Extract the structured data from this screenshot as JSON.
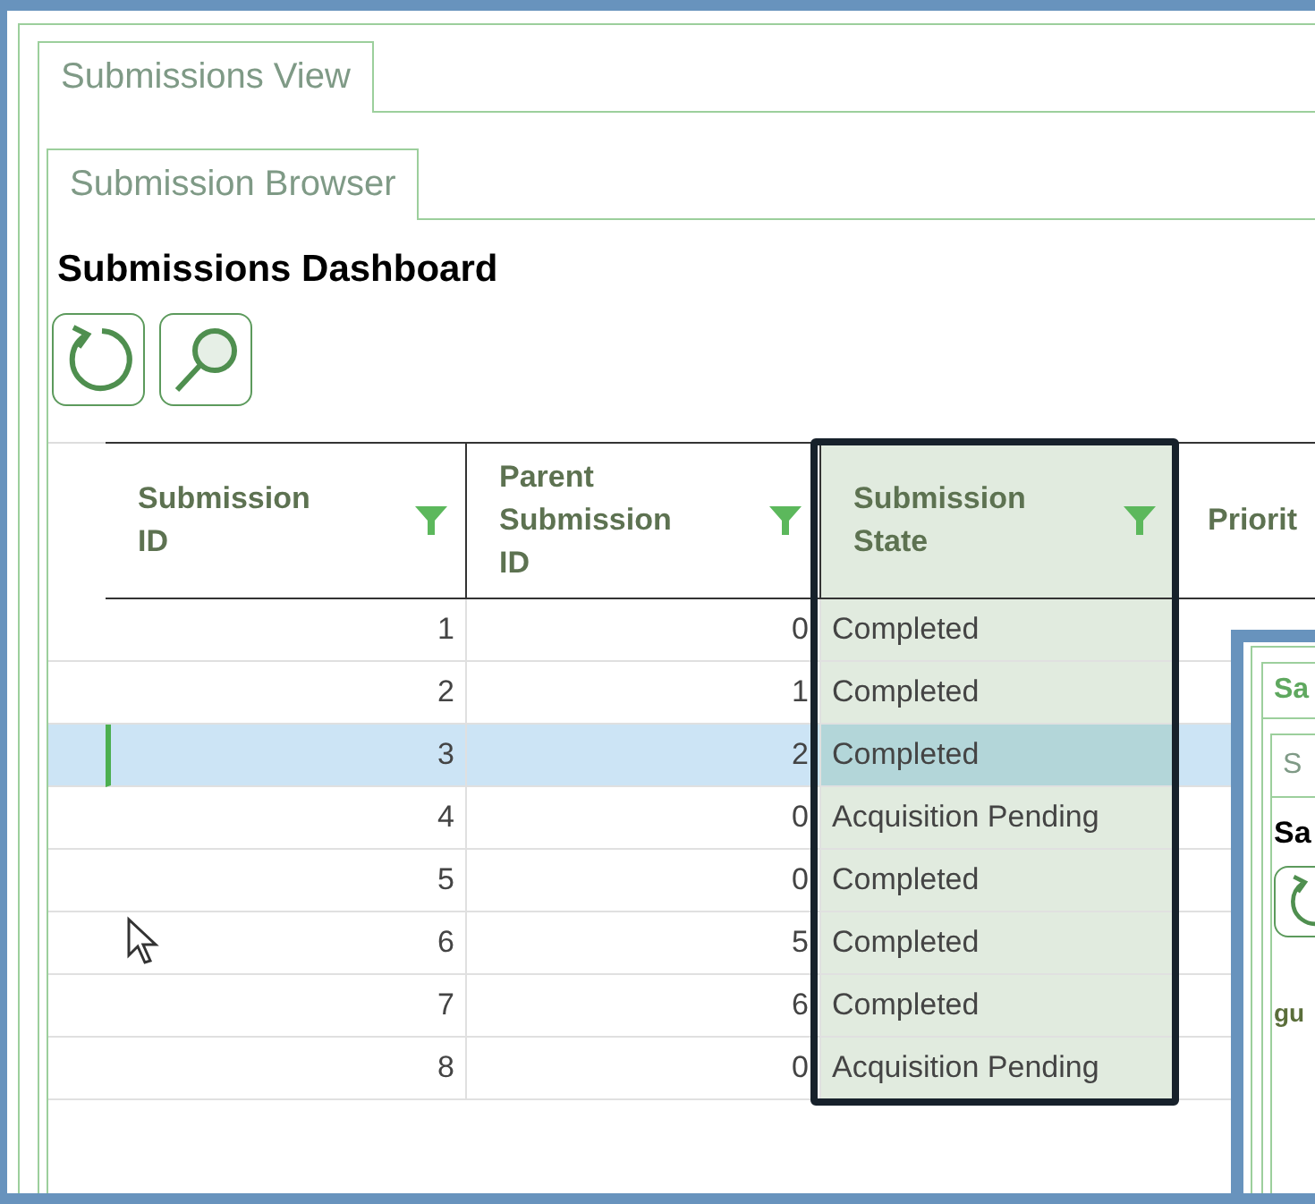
{
  "outer_tabs": [
    {
      "label": "Submissions View",
      "selected": true
    }
  ],
  "inner_tabs": [
    {
      "label": "Submission Browser",
      "selected": true
    }
  ],
  "title": "Submissions Dashboard",
  "toolbar": [
    {
      "kind": "refresh"
    },
    {
      "kind": "search"
    }
  ],
  "table": {
    "columns": [
      {
        "label": "Submission ID",
        "filter": true,
        "highlighted": false
      },
      {
        "label": "Parent Submission ID",
        "filter": true,
        "highlighted": false
      },
      {
        "label": "Submission State",
        "filter": true,
        "highlighted": true
      },
      {
        "label": "Priorit",
        "filter": false,
        "highlighted": false
      }
    ],
    "rows": [
      {
        "selected": false,
        "cells": [
          "1",
          "0",
          "Completed"
        ]
      },
      {
        "selected": false,
        "cells": [
          "2",
          "1",
          "Completed"
        ]
      },
      {
        "selected": true,
        "cells": [
          "3",
          "2",
          "Completed"
        ]
      },
      {
        "selected": false,
        "cells": [
          "4",
          "0",
          "Acquisition Pending"
        ]
      },
      {
        "selected": false,
        "cells": [
          "5",
          "0",
          "Completed"
        ]
      },
      {
        "selected": false,
        "cells": [
          "6",
          "5",
          "Completed"
        ]
      },
      {
        "selected": false,
        "cells": [
          "7",
          "6",
          "Completed"
        ]
      },
      {
        "selected": false,
        "cells": [
          "8",
          "0",
          "Acquisition Pending"
        ]
      }
    ]
  },
  "overlay_window": {
    "tab": "Sa",
    "inner_tab": "S",
    "title": "Sa",
    "label": "gu"
  }
}
